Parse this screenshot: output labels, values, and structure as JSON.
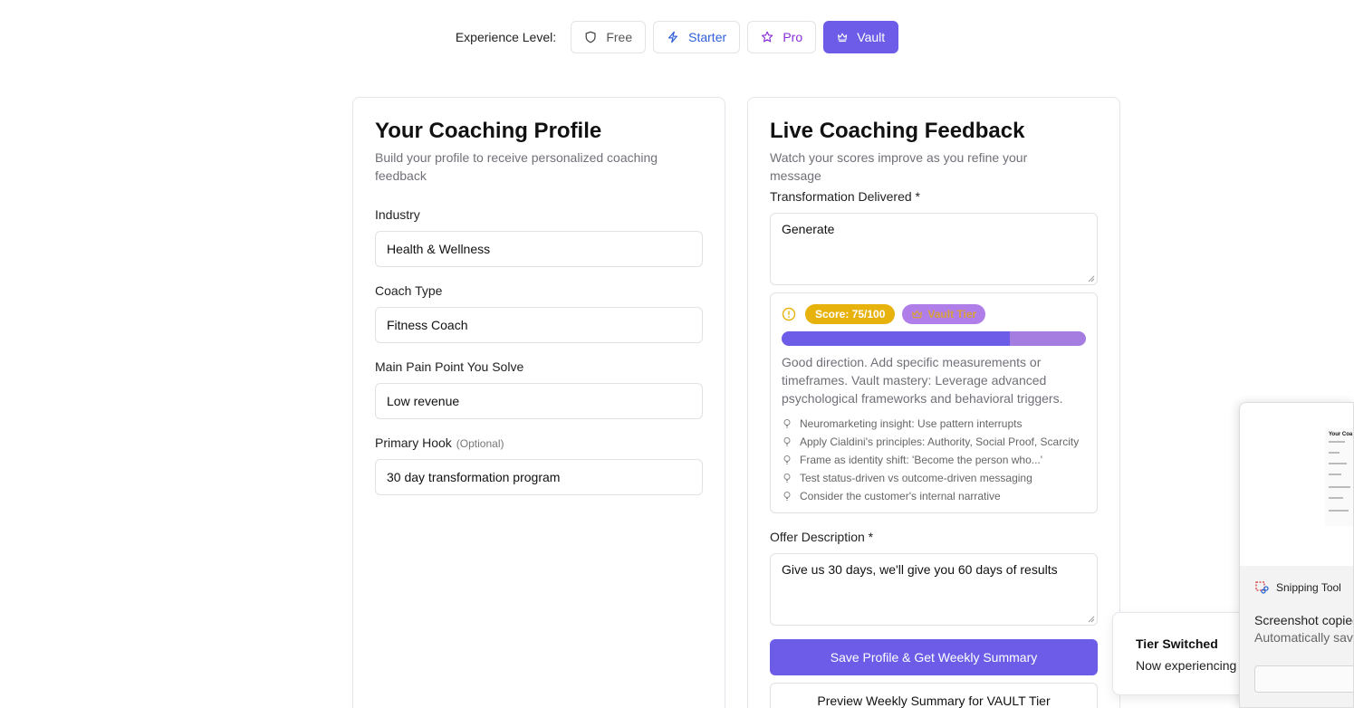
{
  "tier_bar": {
    "label": "Experience Level:",
    "tiers": [
      {
        "label": "Free",
        "icon": "shield-icon",
        "color": "#555555"
      },
      {
        "label": "Starter",
        "icon": "lightning-icon",
        "color": "#2f5fd8"
      },
      {
        "label": "Pro",
        "icon": "star-icon",
        "color": "#8a2fd8"
      },
      {
        "label": "Vault",
        "icon": "crown-icon",
        "color": "#6c5ce7",
        "selected": true
      }
    ]
  },
  "profile": {
    "title": "Your Coaching Profile",
    "subtitle": "Build your profile to receive personalized coaching feedback",
    "industry": {
      "label": "Industry",
      "value": "Health & Wellness"
    },
    "coach_type": {
      "label": "Coach Type",
      "value": "Fitness Coach"
    },
    "pain_point": {
      "label": "Main Pain Point You Solve",
      "value": "Low revenue"
    },
    "hook": {
      "label": "Primary Hook",
      "optional": "(Optional)",
      "value": "30 day transformation program"
    }
  },
  "feedback": {
    "title": "Live Coaching Feedback",
    "subtitle": "Watch your scores improve as you refine your message",
    "transformation": {
      "label": "Transformation Delivered *",
      "value": "Generate"
    },
    "score_badge": "Score: 75/100",
    "score_value": 75,
    "score_max": 100,
    "tier_badge": "Vault Tier",
    "message": "Good direction. Add specific measurements or timeframes. Vault mastery: Leverage advanced psychological frameworks and behavioral triggers.",
    "tips": [
      "Neuromarketing insight: Use pattern interrupts",
      "Apply Cialdini's principles: Authority, Social Proof, Scarcity",
      "Frame as identity shift: 'Become the person who...'",
      "Test status-driven vs outcome-driven messaging",
      "Consider the customer's internal narrative"
    ],
    "offer": {
      "label": "Offer Description *",
      "value": "Give us 30 days, we'll give you 60 days of results"
    },
    "save_button": "Save Profile & Get Weekly Summary",
    "preview_button": "Preview Weekly Summary for VAULT Tier"
  },
  "toast": {
    "title": "Tier Switched",
    "message": "Now experiencing"
  },
  "snipping_tool": {
    "app_name": "Snipping Tool",
    "message": "Screenshot copied",
    "detail": "Automatically save",
    "thumb_title": "Your Coa"
  },
  "colors": {
    "accent": "#6c5ce7",
    "score_badge": "#e8b20c",
    "vault_badge": "#b07ee8"
  }
}
